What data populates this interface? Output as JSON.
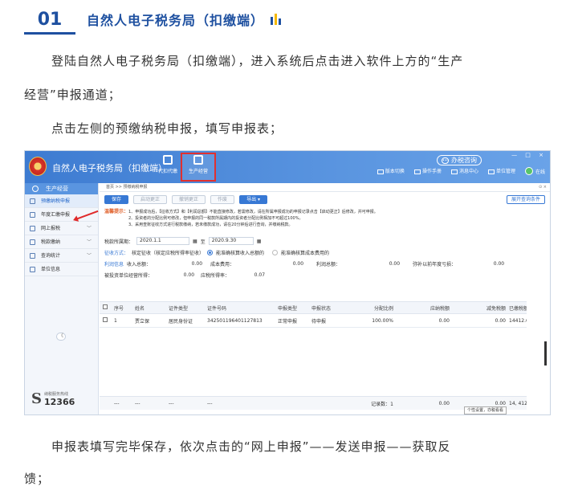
{
  "article": {
    "section_number": "01",
    "section_title": "自然人电子税务局（扣缴端）",
    "para1_line1": "登陆自然人电子税务局（扣缴端），进入系统后点击进入软件上方的“生产",
    "para1_line2": "经营”申报通道；",
    "para2": "点击左侧的预缴纳税申报，填写申报表；",
    "para3_line1": "申报表填写完毕保存，依次点击的“网上申报”——发送申报——获取反",
    "para3_line2": "馈；"
  },
  "app": {
    "title": "自然人电子税务局（扣缴端）",
    "tabs": [
      {
        "label": "代扣代缴"
      },
      {
        "label": "生产经营"
      }
    ],
    "consult_label": "办税咨询",
    "header_links": [
      "版本切换",
      "操作手册",
      "消息中心",
      "单位管理"
    ],
    "online_label": "在线",
    "window_controls": "— □ ×"
  },
  "sidebar": {
    "header": "生产经营",
    "items": [
      {
        "label": "预缴纳税申报",
        "chev": ""
      },
      {
        "label": "年度汇缴申报",
        "chev": ""
      },
      {
        "label": "网上报税",
        "chev": "﹀"
      },
      {
        "label": "税款缴纳",
        "chev": "﹀"
      },
      {
        "label": "查询统计",
        "chev": "﹀"
      },
      {
        "label": "单位信息",
        "chev": ""
      }
    ],
    "collapse": "《",
    "hotline_small": "纳税服务热线",
    "hotline_number": "12366"
  },
  "main": {
    "breadcrumb": "首页 >> 预缴纳税申报",
    "close_label": "⊙ ×",
    "buttons": [
      "保存",
      "启动更正",
      "撤销更正",
      "作废",
      "导出 ▾"
    ],
    "expand_label": "展开查询条件",
    "tips_label": "温馨提示：",
    "tips": [
      "1、申报成功后，【征收方式】和【利润总额】不能直接修改，若需修改，请在所属申报成功的申报记录点击【启动更正】后修改，并可申报。",
      "2、投资者的分配比例可修改，但申报的同一税款所属期内的投资者分配比例相加不可超过100%。",
      "3、采用查账征收方式进行税款缴纳，若未缴款成功，请在20分钟后进行查询，并缴纳税款。"
    ],
    "period_label": "税款所属期：",
    "period_from": "2020.1.1",
    "period_to_label": "至",
    "period_to": "2020.9.30",
    "levy_label": "征收方式：",
    "levy_value": "核定征收（核定应税所得率征收）",
    "opt1": "能准确核算收入总额的",
    "opt2": "能准确核算成本费用的",
    "profit_label": "利润信息",
    "income_label": "收入总额：",
    "income_value": "0.00",
    "cost_label": "成本费用：",
    "cost_value": "0.00",
    "profit_total_label": "利润总额：",
    "profit_total_value": "0.00",
    "loss_label": "弥补以前年度亏损：",
    "loss_value": "0.00",
    "invest_label": "被投资单位经营所得：",
    "invest_value": "0.00",
    "rate_label": "应税所得率：",
    "rate_value": "0.07"
  },
  "table": {
    "headers": [
      "序号",
      "姓名",
      "证件类型",
      "证件号码",
      "申报类型",
      "申报状态",
      "分配比例",
      "应纳税额",
      "减免税额",
      "已缴税额"
    ],
    "rows": [
      {
        "seq": "1",
        "name": "贾立保",
        "id_type": "居民身份证",
        "id_number": "342501196401127813",
        "decl_type": "正常申报",
        "decl_status": "待申报",
        "ratio": "100.00%",
        "tax_due": "0.00",
        "relief": "0.00",
        "paid": "14412.6"
      }
    ],
    "footer": {
      "c1": "---",
      "c2": "---",
      "c3": "---",
      "c4": "---",
      "record_label": "记录数：1",
      "tax_due": "0.00",
      "relief": "0.00",
      "paid": "14, 412.6"
    },
    "tooltip": "个性设置，亦税看看"
  },
  "colors": {
    "brand": "#1e50a0",
    "titlebar": "#3d7bd1",
    "highlight": "#e03030",
    "accent_yellow": "#f5b800"
  }
}
